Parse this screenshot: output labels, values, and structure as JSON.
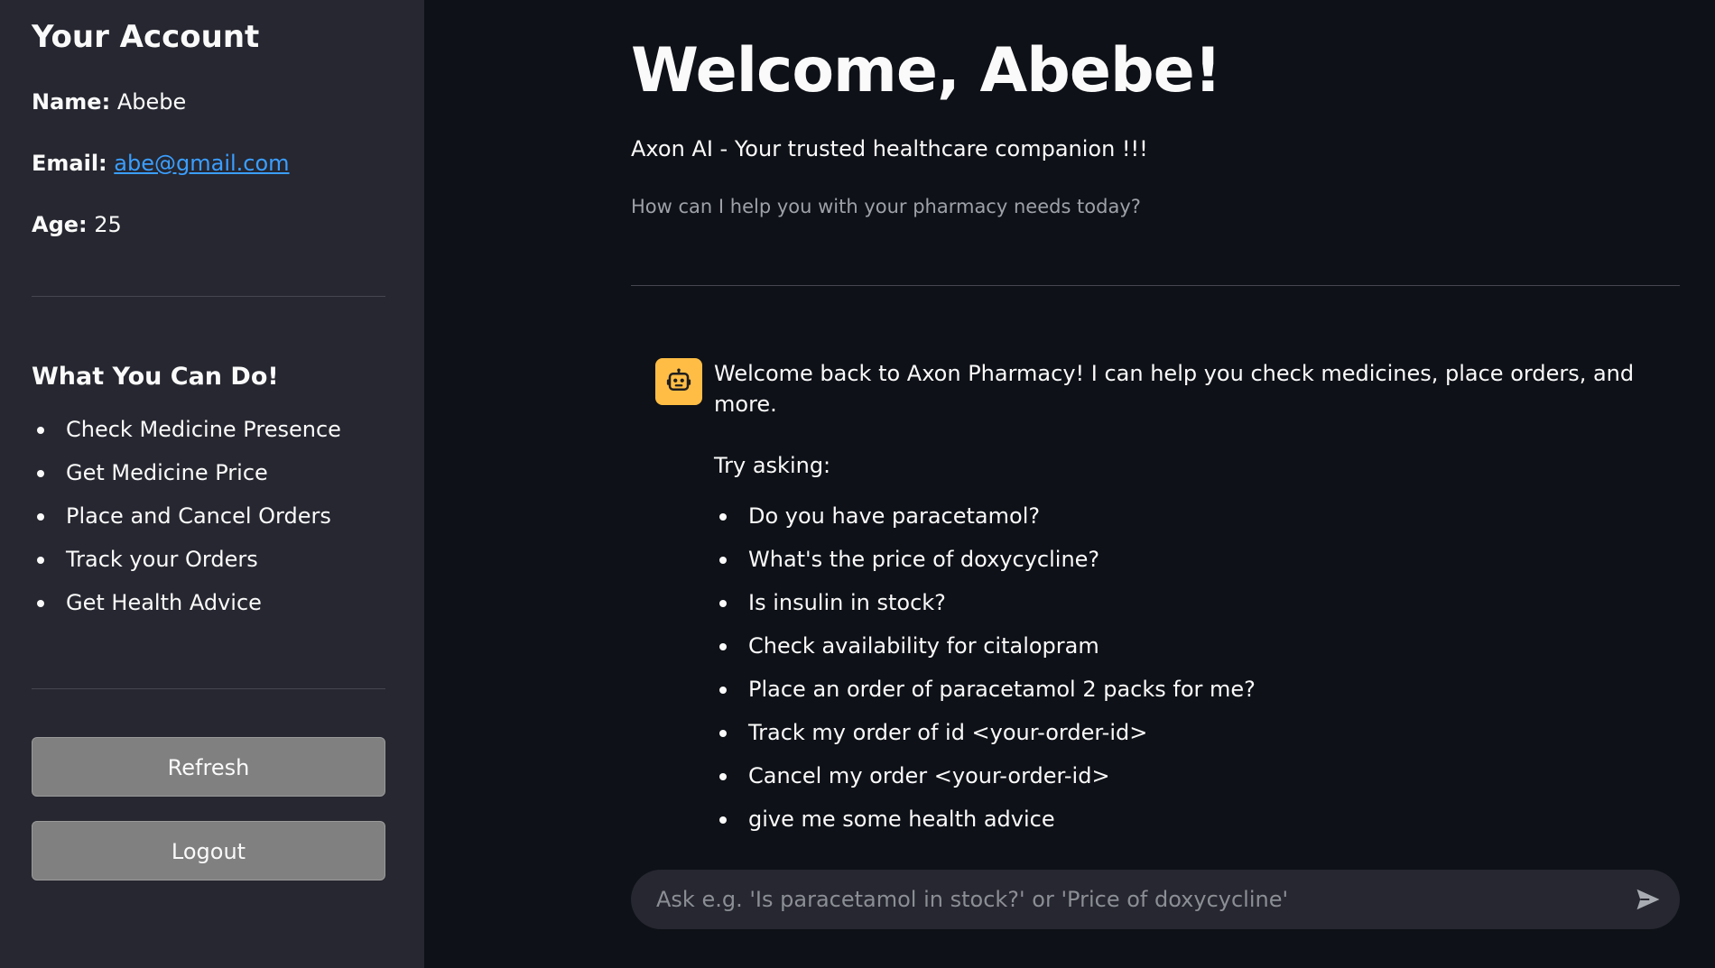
{
  "sidebar": {
    "title": "Your Account",
    "name_label": "Name:",
    "name_value": "Abebe",
    "email_label": "Email:",
    "email_value": "abe@gmail.com",
    "age_label": "Age:",
    "age_value": "25",
    "section_title": "What You Can Do!",
    "items": [
      "Check Medicine Presence",
      "Get Medicine Price",
      "Place and Cancel Orders",
      "Track your Orders",
      "Get Health Advice"
    ],
    "refresh_label": "Refresh",
    "logout_label": "Logout"
  },
  "main": {
    "title": "Welcome, Abebe!",
    "subtitle": "Axon AI - Your trusted healthcare companion !!!",
    "caption": "How can I help you with your pharmacy needs today?"
  },
  "chat": {
    "avatar_icon": "robot-icon",
    "avatar_color": "#ffbd45",
    "message": "Welcome back to Axon Pharmacy! I can help you check medicines, place orders, and more.",
    "try_label": "Try asking:",
    "suggestions": [
      "Do you have paracetamol?",
      "What's the price of doxycycline?",
      "Is insulin in stock?",
      "Check availability for citalopram",
      "Place an order of paracetamol 2 packs for me?",
      "Track my order of id <your-order-id>",
      "Cancel my order <your-order-id>",
      "give me some health advice"
    ],
    "input_placeholder": "Ask e.g. 'Is paracetamol in stock?' or 'Price of doxycycline'",
    "input_value": "",
    "send_icon": "send-icon"
  }
}
